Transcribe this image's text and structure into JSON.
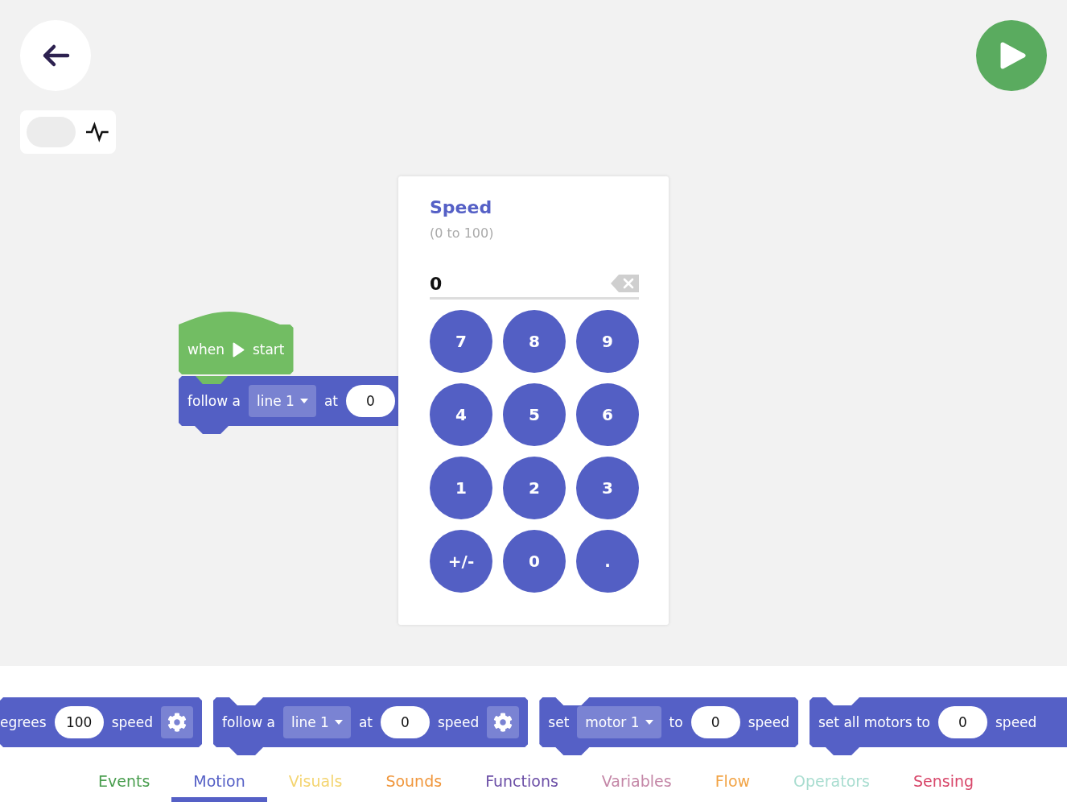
{
  "canvas": {
    "monitor_toggle": {
      "on": false
    },
    "script": [
      {
        "kind": "hat",
        "color": "#72bd63",
        "parts": [
          {
            "kind": "text",
            "text": "when"
          },
          {
            "kind": "play"
          },
          {
            "kind": "text",
            "text": "start"
          }
        ]
      },
      {
        "kind": "stack",
        "color": "#535fc4",
        "parts": [
          {
            "kind": "text",
            "text": "follow a"
          },
          {
            "kind": "dropdown",
            "text": "line 1"
          },
          {
            "kind": "text",
            "text": "at"
          },
          {
            "kind": "number",
            "text": "0"
          }
        ]
      }
    ]
  },
  "number_pad": {
    "title": "Speed",
    "range": "(0 to 100)",
    "value": "0",
    "keys": [
      "7",
      "8",
      "9",
      "4",
      "5",
      "6",
      "1",
      "2",
      "3",
      "+/-",
      "0",
      "."
    ]
  },
  "palette": {
    "blocks": [
      {
        "kind": "stack",
        "parts": [
          {
            "kind": "text",
            "text": "egrees"
          },
          {
            "kind": "number",
            "text": "100"
          },
          {
            "kind": "text",
            "text": "speed"
          },
          {
            "kind": "settings"
          }
        ]
      },
      {
        "kind": "stack",
        "parts": [
          {
            "kind": "text",
            "text": "follow a"
          },
          {
            "kind": "dropdown",
            "text": "line 1"
          },
          {
            "kind": "text",
            "text": "at"
          },
          {
            "kind": "number",
            "text": "0"
          },
          {
            "kind": "text",
            "text": "speed"
          },
          {
            "kind": "settings"
          }
        ]
      },
      {
        "kind": "stack",
        "parts": [
          {
            "kind": "text",
            "text": "set"
          },
          {
            "kind": "dropdown",
            "text": "motor 1"
          },
          {
            "kind": "text",
            "text": "to"
          },
          {
            "kind": "number",
            "text": "0"
          },
          {
            "kind": "text",
            "text": "speed"
          }
        ]
      },
      {
        "kind": "stack",
        "parts": [
          {
            "kind": "text",
            "text": "set all motors to"
          },
          {
            "kind": "number",
            "text": "0"
          },
          {
            "kind": "text",
            "text": "speed"
          }
        ]
      }
    ],
    "categories": [
      {
        "label": "Events",
        "color": "#4a9e4f",
        "selected": false
      },
      {
        "label": "Motion",
        "color": "#5560c6",
        "selected": true
      },
      {
        "label": "Visuals",
        "color": "#f4d571",
        "selected": false
      },
      {
        "label": "Sounds",
        "color": "#f0973d",
        "selected": false
      },
      {
        "label": "Functions",
        "color": "#6b4ea6",
        "selected": false
      },
      {
        "label": "Variables",
        "color": "#c487a7",
        "selected": false
      },
      {
        "label": "Flow",
        "color": "#f2a446",
        "selected": false
      },
      {
        "label": "Operators",
        "color": "#a9ddd0",
        "selected": false
      },
      {
        "label": "Sensing",
        "color": "#d8476a",
        "selected": false
      }
    ]
  }
}
